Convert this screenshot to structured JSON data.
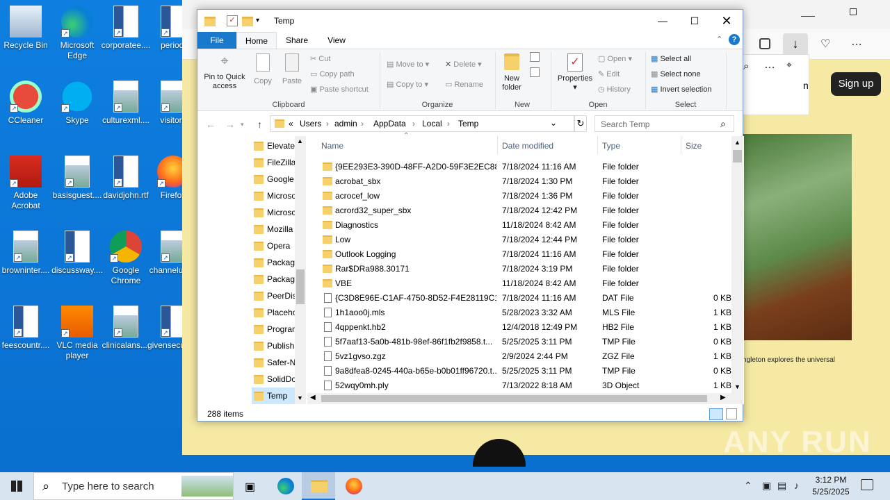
{
  "desktop": {
    "icons": [
      {
        "label": "Recycle Bin",
        "icon": "recycle-bin-icon"
      },
      {
        "label": "Microsoft Edge",
        "icon": "edge-icon"
      },
      {
        "label": "corporatee....",
        "icon": "word-doc-icon"
      },
      {
        "label": "periodi",
        "icon": "word-doc-icon"
      },
      {
        "label": "CCleaner",
        "icon": "ccleaner-icon"
      },
      {
        "label": "Skype",
        "icon": "skype-icon"
      },
      {
        "label": "culturexml....",
        "icon": "image-file-icon"
      },
      {
        "label": "visitors",
        "icon": "image-file-icon"
      },
      {
        "label": "Adobe Acrobat",
        "icon": "acrobat-icon"
      },
      {
        "label": "basisguest....",
        "icon": "image-file-icon"
      },
      {
        "label": "davidjohn.rtf",
        "icon": "word-doc-icon"
      },
      {
        "label": "Firefox",
        "icon": "firefox-icon"
      },
      {
        "label": "browninter....",
        "icon": "image-file-icon"
      },
      {
        "label": "discussway....",
        "icon": "word-doc-icon"
      },
      {
        "label": "Google Chrome",
        "icon": "chrome-icon"
      },
      {
        "label": "channelun....",
        "icon": "image-file-icon"
      },
      {
        "label": "feescountr....",
        "icon": "word-doc-icon"
      },
      {
        "label": "VLC media player",
        "icon": "vlc-icon"
      },
      {
        "label": "clinicalans....",
        "icon": "image-file-icon"
      },
      {
        "label": "givensecuri....",
        "icon": "word-doc-icon"
      }
    ]
  },
  "browser": {
    "signup_label": "Sign up",
    "partial_text": "n",
    "caption": "ngleton explores the universal"
  },
  "watermark": "ANY RUN",
  "explorer": {
    "title": "Temp",
    "tabs": [
      "File",
      "Home",
      "Share",
      "View"
    ],
    "ribbon": {
      "pin_label": "Pin to Quick access",
      "copy_label": "Copy",
      "paste_label": "Paste",
      "cut_label": "Cut",
      "copy_path_label": "Copy path",
      "paste_shortcut_label": "Paste shortcut",
      "clipboard_group": "Clipboard",
      "move_to_label": "Move to",
      "copy_to_label": "Copy to",
      "delete_label": "Delete",
      "rename_label": "Rename",
      "organize_group": "Organize",
      "new_folder_label": "New folder",
      "new_group": "New",
      "properties_label": "Properties",
      "open_label": "Open",
      "edit_label": "Edit",
      "history_label": "History",
      "open_group": "Open",
      "select_all_label": "Select all",
      "select_none_label": "Select none",
      "invert_selection_label": "Invert selection",
      "select_group": "Select"
    },
    "address": {
      "overflow": "«",
      "crumbs": [
        "Users",
        "admin",
        "AppData",
        "Local",
        "Temp"
      ],
      "search_placeholder": "Search Temp"
    },
    "nav_items": [
      {
        "label": "Elevate",
        "selected": false
      },
      {
        "label": "FileZilla",
        "selected": false
      },
      {
        "label": "Google",
        "selected": false
      },
      {
        "label": "Microso",
        "selected": false
      },
      {
        "label": "Microso",
        "selected": false
      },
      {
        "label": "Mozilla",
        "selected": false
      },
      {
        "label": "Opera",
        "selected": false
      },
      {
        "label": "Packag",
        "selected": false
      },
      {
        "label": "Packag",
        "selected": false
      },
      {
        "label": "PeerDis",
        "selected": false
      },
      {
        "label": "Placeho",
        "selected": false
      },
      {
        "label": "Progran",
        "selected": false
      },
      {
        "label": "Publish",
        "selected": false
      },
      {
        "label": "Safer-N",
        "selected": false
      },
      {
        "label": "SolidDo",
        "selected": false
      },
      {
        "label": "Temp",
        "selected": true
      }
    ],
    "columns": {
      "name": "Name",
      "date": "Date modified",
      "type": "Type",
      "size": "Size"
    },
    "files": [
      {
        "name": "{9EE293E3-390D-48FF-A2D0-59F3E2EC88...",
        "date": "7/18/2024 11:16 AM",
        "type": "File folder",
        "size": "",
        "kind": "folder"
      },
      {
        "name": "acrobat_sbx",
        "date": "7/18/2024 1:30 PM",
        "type": "File folder",
        "size": "",
        "kind": "folder"
      },
      {
        "name": "acrocef_low",
        "date": "7/18/2024 1:36 PM",
        "type": "File folder",
        "size": "",
        "kind": "folder"
      },
      {
        "name": "acrord32_super_sbx",
        "date": "7/18/2024 12:42 PM",
        "type": "File folder",
        "size": "",
        "kind": "folder"
      },
      {
        "name": "Diagnostics",
        "date": "11/18/2024 8:42 AM",
        "type": "File folder",
        "size": "",
        "kind": "folder"
      },
      {
        "name": "Low",
        "date": "7/18/2024 12:44 PM",
        "type": "File folder",
        "size": "",
        "kind": "folder"
      },
      {
        "name": "Outlook Logging",
        "date": "7/18/2024 11:16 AM",
        "type": "File folder",
        "size": "",
        "kind": "folder"
      },
      {
        "name": "Rar$DRa988.30171",
        "date": "7/18/2024 3:19 PM",
        "type": "File folder",
        "size": "",
        "kind": "folder"
      },
      {
        "name": "VBE",
        "date": "11/18/2024 8:42 AM",
        "type": "File folder",
        "size": "",
        "kind": "folder"
      },
      {
        "name": "{C3D8E96E-C1AF-4750-8D52-F4E28119C1...",
        "date": "7/18/2024 11:16 AM",
        "type": "DAT File",
        "size": "0 KB",
        "kind": "file"
      },
      {
        "name": "1h1aoo0j.mls",
        "date": "5/28/2023 3:32 AM",
        "type": "MLS File",
        "size": "1 KB",
        "kind": "file"
      },
      {
        "name": "4qppenkt.hb2",
        "date": "12/4/2018 12:49 PM",
        "type": "HB2 File",
        "size": "1 KB",
        "kind": "file"
      },
      {
        "name": "5f7aaf13-5a0b-481b-98ef-86f1fb2f9858.t...",
        "date": "5/25/2025 3:11 PM",
        "type": "TMP File",
        "size": "0 KB",
        "kind": "file"
      },
      {
        "name": "5vz1gvso.zgz",
        "date": "2/9/2024 2:44 PM",
        "type": "ZGZ File",
        "size": "1 KB",
        "kind": "file"
      },
      {
        "name": "9a8dfea8-0245-440a-b65e-b0b01ff96720.t...",
        "date": "5/25/2025 3:11 PM",
        "type": "TMP File",
        "size": "0 KB",
        "kind": "file"
      },
      {
        "name": "52wqy0mh.ply",
        "date": "7/13/2022 8:18 AM",
        "type": "3D Object",
        "size": "1 KB",
        "kind": "file"
      }
    ],
    "status_items": "288 items"
  },
  "taskbar": {
    "search_placeholder": "Type here to search",
    "time": "3:12 PM",
    "date": "5/25/2025"
  }
}
